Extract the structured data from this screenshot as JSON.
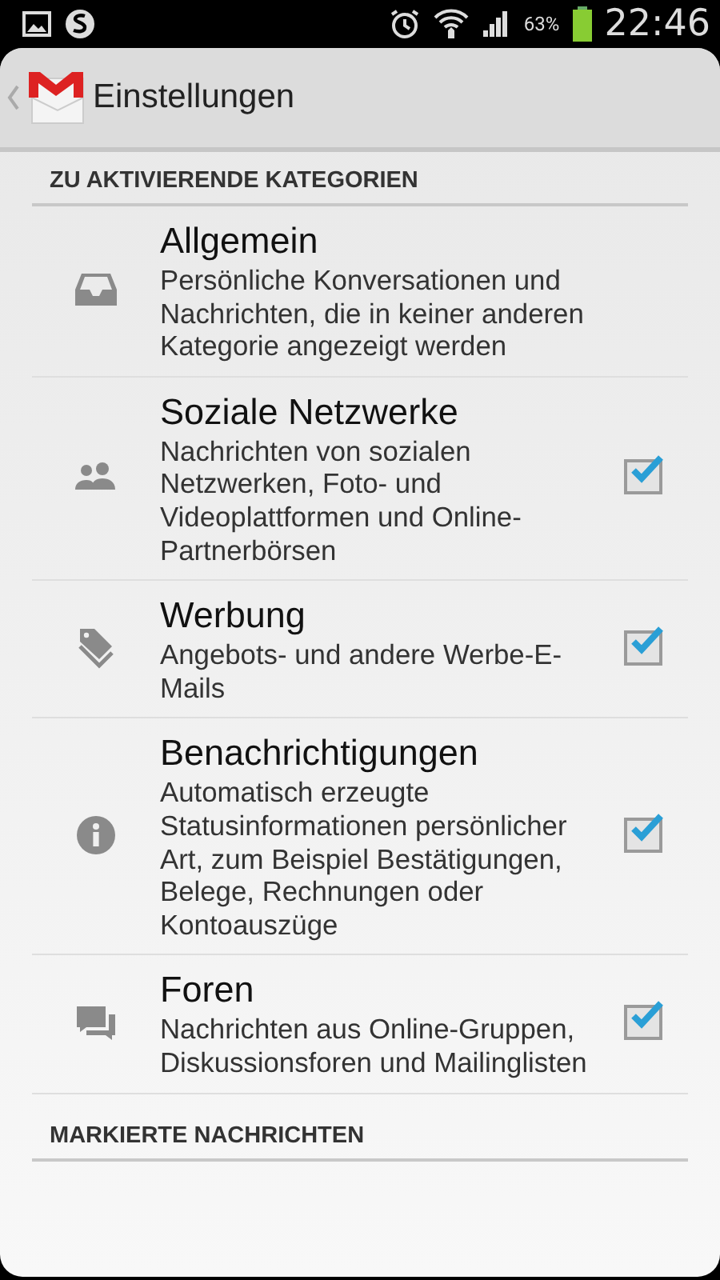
{
  "status_bar": {
    "battery": "63%",
    "time": "22:46"
  },
  "action_bar": {
    "title": "Einstellungen"
  },
  "sections": [
    {
      "header": "ZU AKTIVIERENDE KATEGORIEN",
      "items": [
        {
          "kind": "plain",
          "title": "Allgemein",
          "description": "Persönliche Konversationen und Nachrichten, die in keiner anderen Kategorie angezeigt werden"
        },
        {
          "kind": "checkbox",
          "title": "Soziale Netzwerke",
          "description": "Nachrichten von sozialen Netzwerken, Foto- und Videoplattformen und Online-Partnerbörsen",
          "checked": true
        },
        {
          "kind": "checkbox",
          "title": "Werbung",
          "description": "Angebots- und andere Werbe-E-Mails",
          "checked": true
        },
        {
          "kind": "checkbox",
          "title": "Benachrichtigungen",
          "description": "Automatisch erzeugte Statusinformationen persönlicher Art, zum Beispiel Bestätigungen, Belege, Rechnungen oder Kontoauszüge",
          "checked": true
        },
        {
          "kind": "checkbox",
          "title": "Foren",
          "description": "Nachrichten aus Online-Gruppen, Diskussionsforen und Mailinglisten",
          "checked": true
        }
      ]
    },
    {
      "header": "MARKIERTE NACHRICHTEN"
    }
  ]
}
